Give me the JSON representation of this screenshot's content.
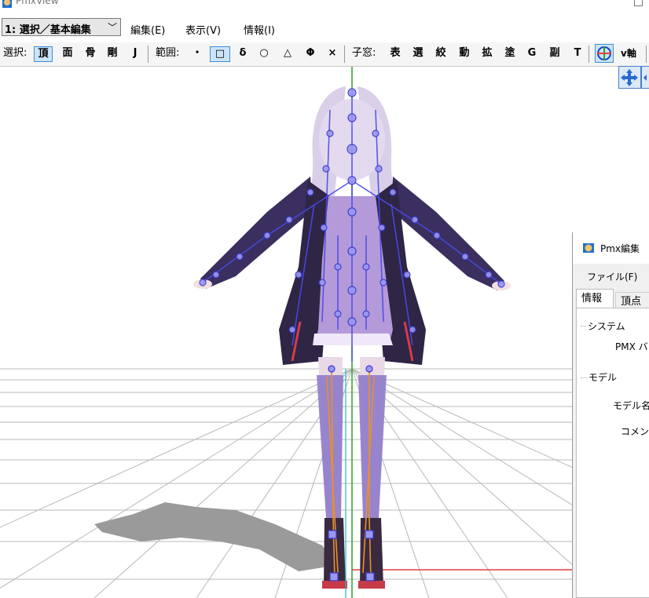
{
  "window": {
    "title": "PmxView"
  },
  "menubar": {
    "mode_select": "1: 選択／基本編集",
    "items": [
      "編集(E)",
      "表示(V)",
      "情報(I)"
    ]
  },
  "toolbar": {
    "select_label": "選択:",
    "select_buttons": [
      "頂",
      "面",
      "骨",
      "剛",
      "J"
    ],
    "range_label": "範囲:",
    "range_buttons": [
      "・",
      "□",
      "δ",
      "○",
      "△",
      "Φ",
      "×"
    ],
    "child_label": "子窓:",
    "child_buttons": [
      "表",
      "選",
      "絞",
      "動",
      "拡",
      "塗",
      "G",
      "副",
      "T"
    ],
    "axis_label": "v軸"
  },
  "pmx_edit": {
    "title": "Pmx編集",
    "menu_file": "ファイル(F)",
    "tabs": [
      "情報",
      "頂点"
    ],
    "group_system": "システム",
    "pmx_version_label": "PMX バ",
    "group_model": "モデル",
    "model_name_label": "モデル名",
    "comment_label": "コメント"
  },
  "colors": {
    "accent_blue": "#3f8fd8",
    "bone_blue": "#4a4ae8",
    "bone_orange": "#e8902a",
    "grid": "#b8b8b8",
    "axis_green": "#2ea02e",
    "axis_red": "#e04040"
  }
}
